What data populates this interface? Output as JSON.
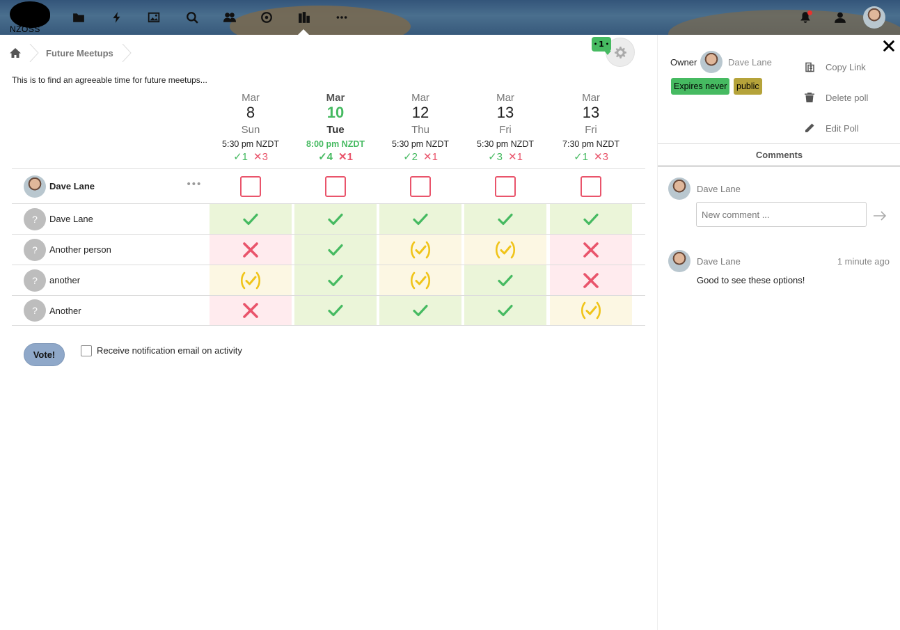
{
  "header": {
    "logo_text": "NZOSS",
    "apps": [
      "files-icon",
      "activity-icon",
      "photos-icon",
      "search-icon",
      "contacts-icon",
      "circles-icon",
      "polls-icon",
      "more-icon"
    ],
    "active_app": "polls-icon"
  },
  "breadcrumb": {
    "home": "home-icon",
    "poll_title": "Future Meetups"
  },
  "comment_badge": "1",
  "description": "This is to find an agreeable time for future meetups...",
  "options": [
    {
      "month": "Mar",
      "day": "8",
      "weekday": "Sun",
      "time": "5:30 pm NZDT",
      "yes": "1",
      "no": "3",
      "best": false
    },
    {
      "month": "Mar",
      "day": "10",
      "weekday": "Tue",
      "time": "8:00 pm NZDT",
      "yes": "4",
      "no": "1",
      "best": true
    },
    {
      "month": "Mar",
      "day": "12",
      "weekday": "Thu",
      "time": "5:30 pm NZDT",
      "yes": "2",
      "no": "1",
      "best": false
    },
    {
      "month": "Mar",
      "day": "13",
      "weekday": "Fri",
      "time": "5:30 pm NZDT",
      "yes": "3",
      "no": "1",
      "best": false
    },
    {
      "month": "Mar",
      "day": "13",
      "weekday": "Fri",
      "time": "7:30 pm NZDT",
      "yes": "1",
      "no": "3",
      "best": false
    }
  ],
  "current_user": {
    "name": "Dave Lane",
    "votes": [
      "unvoted",
      "unvoted",
      "unvoted",
      "unvoted",
      "unvoted"
    ]
  },
  "participants": [
    {
      "name": "Dave Lane",
      "avatar": "?",
      "votes": [
        "yes",
        "yes",
        "yes",
        "yes",
        "yes"
      ]
    },
    {
      "name": "Another person",
      "avatar": "?",
      "votes": [
        "no",
        "yes",
        "maybe",
        "maybe",
        "no"
      ]
    },
    {
      "name": "another",
      "avatar": "?",
      "votes": [
        "maybe",
        "yes",
        "maybe",
        "yes",
        "no"
      ]
    },
    {
      "name": "Another",
      "avatar": "?",
      "votes": [
        "no",
        "yes",
        "yes",
        "yes",
        "maybe"
      ]
    }
  ],
  "vote_button": "Vote!",
  "notify_label": "Receive notification email on activity",
  "sidebar": {
    "owner_label": "Owner",
    "owner_name": "Dave Lane",
    "badges": {
      "expires": "Expires never",
      "access": "public"
    },
    "actions": {
      "copy": "Copy Link",
      "delete": "Delete poll",
      "edit": "Edit Poll"
    },
    "tab": "Comments",
    "me_name": "Dave Lane",
    "comment_placeholder": "New comment ...",
    "comments": [
      {
        "author": "Dave Lane",
        "time": "1 minute ago",
        "text": "Good to see these options!"
      }
    ]
  },
  "colors": {
    "yes": "#46ba61",
    "no": "#e9546b",
    "maybe": "#f0c419",
    "brand": "#0082c9"
  }
}
